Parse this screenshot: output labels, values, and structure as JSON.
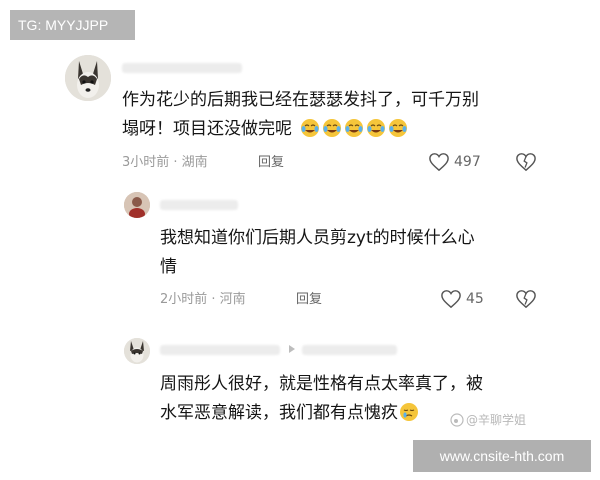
{
  "badge": {
    "text": "TG: MYYJJPP"
  },
  "comments": [
    {
      "text_line1": "作为花少的后期我已经在瑟瑟发抖了，可千万别",
      "text_line2": "塌呀！项目还没做完呢",
      "emoji_count": 5,
      "meta": "3小时前 · 湖南",
      "reply_label": "回复",
      "likes": "497"
    },
    {
      "text_line1": "我想知道你们后期人员剪zyt的时候什么心",
      "text_line2": "情",
      "meta": "2小时前 · 河南",
      "reply_label": "回复",
      "likes": "45"
    },
    {
      "text_line1": "周雨彤人很好，就是性格有点太率真了，被",
      "text_line2": "水军恶意解读，我们都有点愧疚"
    }
  ],
  "source_watermark": "@辛聊学姐",
  "watermark": {
    "text": "www.cnsite-hth.com"
  },
  "colors": {
    "text": "#151515",
    "meta": "#9a9a9a",
    "badge_bg": "#b5b5b5"
  }
}
